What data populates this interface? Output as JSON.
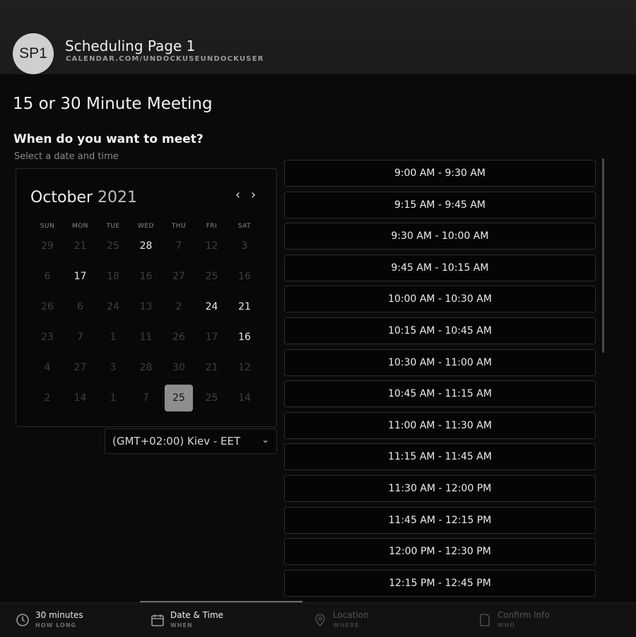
{
  "header": {
    "avatar_initials": "SP1",
    "page_name": "Scheduling Page 1",
    "page_url": "CALENDAR.COM/UNDOCKUSEUNDOCKUSER"
  },
  "meeting_title": "15 or 30 Minute Meeting",
  "prompt": {
    "question": "When do you want to meet?",
    "subtext": "Select a date and time"
  },
  "calendar": {
    "month": "October",
    "year": "2021",
    "prev_glyph": "‹",
    "next_glyph": "›",
    "weekdays": [
      "SUN",
      "MON",
      "TUE",
      "WED",
      "THU",
      "FRI",
      "SAT"
    ],
    "rows": [
      [
        {
          "d": "29",
          "a": false
        },
        {
          "d": "21",
          "a": false
        },
        {
          "d": "25",
          "a": false
        },
        {
          "d": "28",
          "a": true
        },
        {
          "d": "7",
          "a": false
        },
        {
          "d": "12",
          "a": false
        },
        {
          "d": "3",
          "a": false
        }
      ],
      [
        {
          "d": "6",
          "a": false
        },
        {
          "d": "17",
          "a": true
        },
        {
          "d": "18",
          "a": false
        },
        {
          "d": "16",
          "a": false
        },
        {
          "d": "27",
          "a": false
        },
        {
          "d": "25",
          "a": false
        },
        {
          "d": "16",
          "a": false
        }
      ],
      [
        {
          "d": "26",
          "a": false
        },
        {
          "d": "6",
          "a": false
        },
        {
          "d": "24",
          "a": false
        },
        {
          "d": "13",
          "a": false
        },
        {
          "d": "2",
          "a": false
        },
        {
          "d": "24",
          "a": true
        },
        {
          "d": "21",
          "a": true
        }
      ],
      [
        {
          "d": "23",
          "a": false
        },
        {
          "d": "7",
          "a": false
        },
        {
          "d": "1",
          "a": false
        },
        {
          "d": "11",
          "a": false
        },
        {
          "d": "26",
          "a": false
        },
        {
          "d": "17",
          "a": false
        },
        {
          "d": "16",
          "a": true
        }
      ],
      [
        {
          "d": "4",
          "a": false
        },
        {
          "d": "27",
          "a": false
        },
        {
          "d": "3",
          "a": false
        },
        {
          "d": "28",
          "a": false
        },
        {
          "d": "30",
          "a": false
        },
        {
          "d": "21",
          "a": false
        },
        {
          "d": "12",
          "a": false
        }
      ],
      [
        {
          "d": "2",
          "a": false
        },
        {
          "d": "14",
          "a": false
        },
        {
          "d": "1",
          "a": false
        },
        {
          "d": "7",
          "a": false
        },
        {
          "d": "25",
          "a": true,
          "sel": true
        },
        {
          "d": "25",
          "a": false
        },
        {
          "d": "14",
          "a": false
        }
      ]
    ]
  },
  "timezone": {
    "value": "(GMT+02:00) Kiev - EET",
    "chevron": "⌄"
  },
  "time_slots": [
    "9:00 AM - 9:30 AM",
    "9:15 AM - 9:45 AM",
    "9:30 AM - 10:00 AM",
    "9:45 AM - 10:15 AM",
    "10:00 AM - 10:30 AM",
    "10:15 AM - 10:45 AM",
    "10:30 AM - 11:00 AM",
    "10:45 AM - 11:15 AM",
    "11:00 AM - 11:30 AM",
    "11:15 AM - 11:45 AM",
    "11:30 AM - 12:00 PM",
    "11:45 AM - 12:15 PM",
    "12:00 PM - 12:30 PM",
    "12:15 PM - 12:45 PM"
  ],
  "footer": {
    "steps": [
      {
        "title": "30 minutes",
        "subtitle": "HOW LONG",
        "icon": "clock-icon",
        "state": "done"
      },
      {
        "title": "Date & Time",
        "subtitle": "WHEN",
        "icon": "calendar-icon",
        "state": "active"
      },
      {
        "title": "Location",
        "subtitle": "WHERE",
        "icon": "location-pin-icon",
        "state": "upcoming"
      },
      {
        "title": "Confirm Info",
        "subtitle": "WHO",
        "icon": "document-icon",
        "state": "upcoming"
      }
    ]
  }
}
